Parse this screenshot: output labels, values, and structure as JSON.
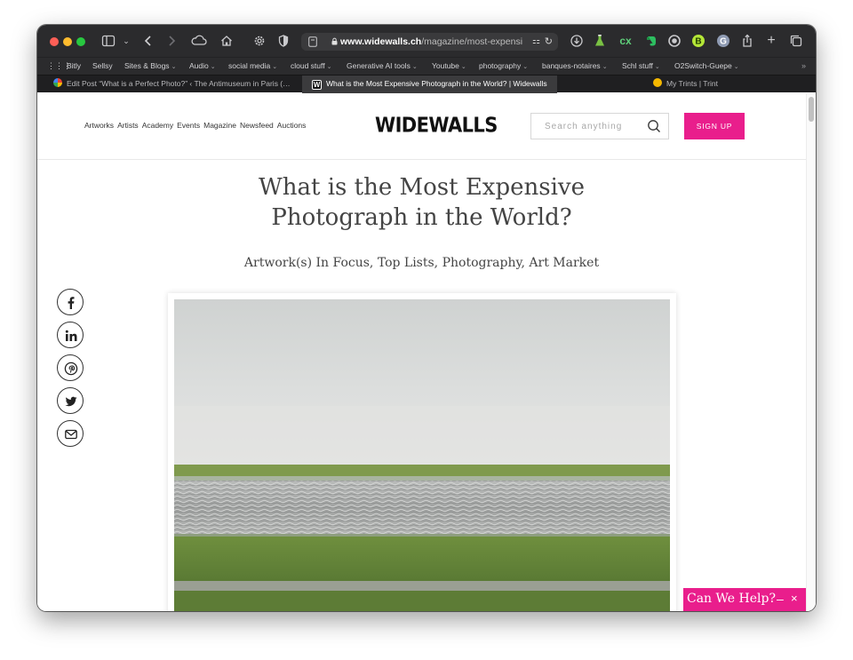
{
  "browser": {
    "url_domain": "www.widewalls.ch",
    "url_path": "/magazine/most-expensi",
    "bookmarks": [
      {
        "label": "Bitly",
        "menu": false
      },
      {
        "label": "Sellsy",
        "menu": false
      },
      {
        "label": "Sites & Blogs",
        "menu": true
      },
      {
        "label": "Audio",
        "menu": true
      },
      {
        "label": "social media",
        "menu": true
      },
      {
        "label": "cloud stuff",
        "menu": true
      },
      {
        "label": "Generative AI tools",
        "menu": true
      },
      {
        "label": "Youtube",
        "menu": true
      },
      {
        "label": "photography",
        "menu": true
      },
      {
        "label": "banques-notaires",
        "menu": true
      },
      {
        "label": "Schl stuff",
        "menu": true
      },
      {
        "label": "O2Switch-Guepe",
        "menu": true
      }
    ],
    "tabs": [
      {
        "label": "Edit Post “What is a Perfect Photo?” ‹ The Antimuseum in Paris (…",
        "active": false
      },
      {
        "label": "What is the Most Expensive Photograph in the World? | Widewalls",
        "active": true
      },
      {
        "label": "My Trints | Trint",
        "active": false
      }
    ]
  },
  "site": {
    "nav": [
      "Artworks",
      "Artists",
      "Academy",
      "Events",
      "Magazine",
      "Newsfeed",
      "Auctions"
    ],
    "logo": "WIDEWALLS",
    "search_placeholder": "Search anything",
    "signup_label": "SIGN UP"
  },
  "article": {
    "title_line1": "What is the Most Expensive",
    "title_line2": "Photograph in the World?",
    "categories": "Artwork(s) In Focus, Top Lists, Photography, Art Market"
  },
  "share_icons": [
    "facebook-icon",
    "linkedin-icon",
    "pinterest-icon",
    "twitter-icon",
    "email-icon"
  ],
  "help_widget": {
    "label": "Can We Help?",
    "minimize": "–",
    "close": "×"
  },
  "colors": {
    "brand_pink": "#e91e8c",
    "toolbar_bg": "#2b2b2d",
    "tab_bar_bg": "#1f1f21"
  }
}
